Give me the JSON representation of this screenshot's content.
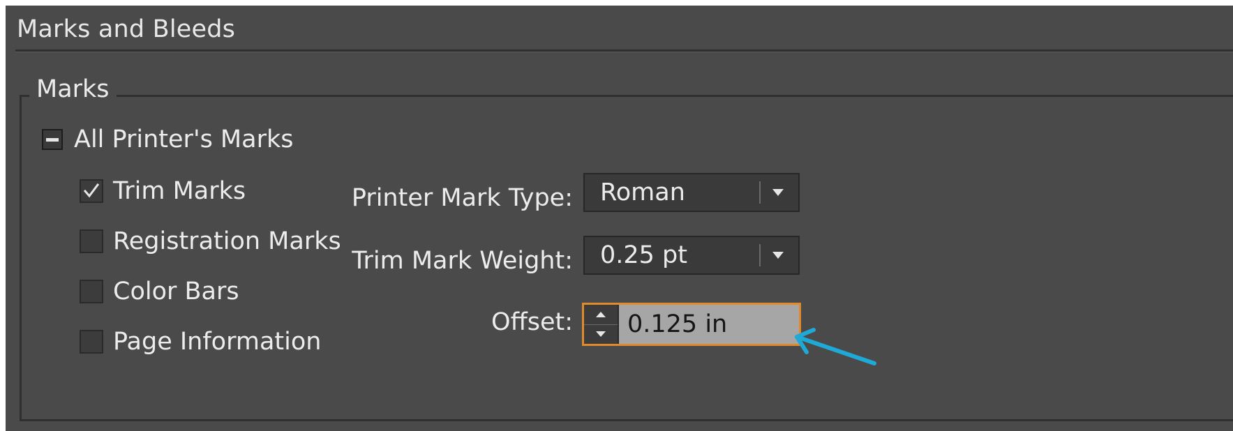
{
  "panel": {
    "title": "Marks and Bleeds"
  },
  "marks_group": {
    "legend": "Marks",
    "all_printers_marks": {
      "label": "All Printer's Marks",
      "state": "mixed"
    },
    "checkboxes": [
      {
        "label": "Trim Marks",
        "checked": true
      },
      {
        "label": "Registration Marks",
        "checked": false
      },
      {
        "label": "Color Bars",
        "checked": false
      },
      {
        "label": "Page Information",
        "checked": false
      }
    ],
    "printer_mark_type": {
      "label": "Printer Mark Type:",
      "value": "Roman"
    },
    "trim_mark_weight": {
      "label": "Trim Mark Weight:",
      "value": "0.25 pt"
    },
    "offset": {
      "label": "Offset:",
      "value": "0.125 in"
    }
  },
  "colors": {
    "panel_bg": "#4a4a4a",
    "focus_border": "#e08a2c",
    "callout_arrow": "#1fa9d6"
  },
  "icons": {
    "mixed_state": "minus-icon",
    "checked": "checkmark-icon",
    "dropdown": "triangle-down-icon",
    "spin_up": "triangle-up-icon",
    "spin_down": "triangle-down-icon",
    "callout": "arrow-icon"
  }
}
